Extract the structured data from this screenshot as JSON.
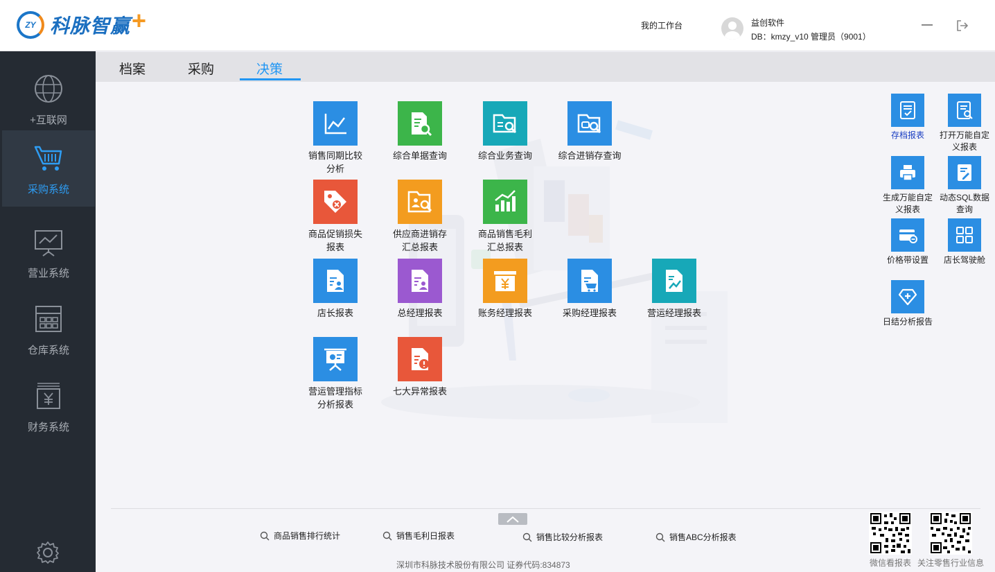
{
  "header": {
    "logo_badge": "ZY",
    "logo_text": "科脉智赢",
    "workbench": "我的工作台",
    "user_name": "益创软件",
    "user_db": "DB：kmzy_v10   管理员（9001）"
  },
  "sidebar": {
    "items": [
      {
        "label": "+互联网",
        "icon": "globe-icon"
      },
      {
        "label": "采购系统",
        "icon": "cart-icon"
      },
      {
        "label": "营业系统",
        "icon": "presentation-icon"
      },
      {
        "label": "仓库系统",
        "icon": "warehouse-icon"
      },
      {
        "label": "财务系统",
        "icon": "finance-icon"
      }
    ],
    "active_index": 1,
    "settings_icon": "gear-icon"
  },
  "tabs": [
    "档案",
    "采购",
    "决策"
  ],
  "active_tab": "决策",
  "tiles": [
    {
      "label": "销售同期比较分析",
      "color": "#2b8ee3",
      "icon": "line-chart-icon"
    },
    {
      "label": "综合单据查询",
      "color": "#3cb54a",
      "icon": "document-search-icon"
    },
    {
      "label": "综合业务查询",
      "color": "#17a8b8",
      "icon": "folder-search-icon"
    },
    {
      "label": "综合进销存查询",
      "color": "#2b8ee3",
      "icon": "folder-box-search-icon"
    },
    {
      "label": "商品促销损失报表",
      "color": "#e8573a",
      "icon": "tag-icon"
    },
    {
      "label": "供应商进销存汇总报表",
      "color": "#f39c1f",
      "icon": "supplier-search-icon"
    },
    {
      "label": "商品销售毛利汇总报表",
      "color": "#3cb54a",
      "icon": "bar-chart-icon"
    },
    {
      "label": "店长报表",
      "color": "#2b8ee3",
      "icon": "store-manager-report-icon"
    },
    {
      "label": "总经理报表",
      "color": "#9b59d0",
      "icon": "gm-report-icon"
    },
    {
      "label": "账务经理报表",
      "color": "#f39c1f",
      "icon": "yen-box-icon"
    },
    {
      "label": "采购经理报表",
      "color": "#2b8ee3",
      "icon": "cart-report-icon"
    },
    {
      "label": "营运经理报表",
      "color": "#17a8b8",
      "icon": "trend-report-icon"
    },
    {
      "label": "营运管理指标分析报表",
      "color": "#2b8ee3",
      "icon": "presentation-board-icon"
    },
    {
      "label": "七大异常报表",
      "color": "#e8573a",
      "icon": "alert-report-icon"
    }
  ],
  "right_tiles": [
    {
      "label": "存档报表",
      "icon": "archive-report-icon"
    },
    {
      "label": "打开万能自定义报表",
      "icon": "search-report-icon"
    },
    {
      "label": "生成万能自定义报表",
      "icon": "printer-icon"
    },
    {
      "label": "动态SQL数据查询",
      "icon": "edit-document-icon"
    },
    {
      "label": "价格带设置",
      "icon": "card-icon"
    },
    {
      "label": "店长驾驶舱",
      "icon": "dashboard-grid-icon"
    },
    {
      "label": "日结分析报告",
      "icon": "diamond-plus-icon"
    }
  ],
  "quick_links": [
    "商品销售排行统计",
    "销售毛利日报表",
    "销售比较分析报表",
    "销售ABC分析报表"
  ],
  "footer": "深圳市科脉技术股份有限公司   证券代码:834873",
  "qr": [
    {
      "label": "微信看报表"
    },
    {
      "label": "关注零售行业信息"
    }
  ]
}
